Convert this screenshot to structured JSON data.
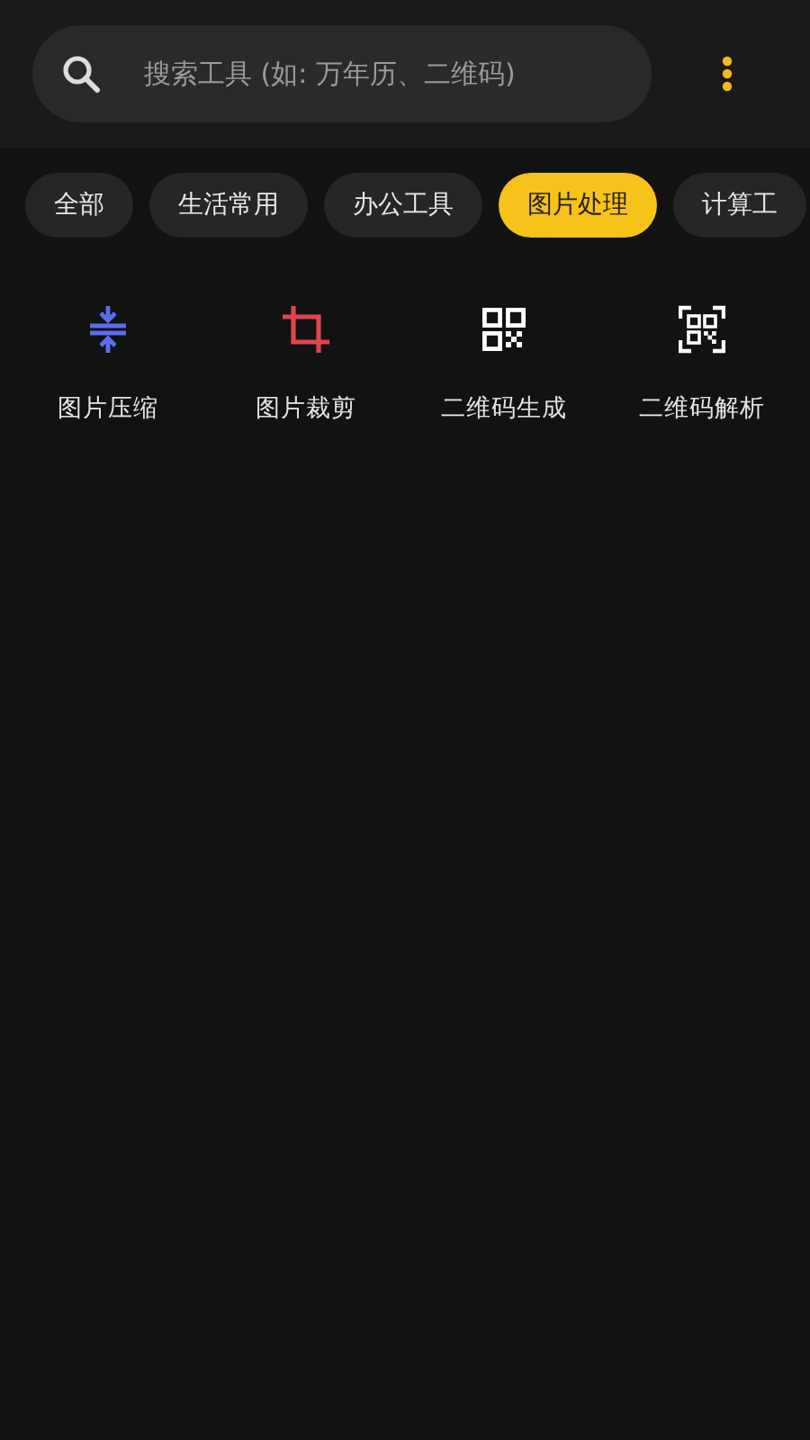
{
  "search": {
    "placeholder": "搜索工具 (如: 万年历、二维码)"
  },
  "tabs": [
    {
      "label": "全部",
      "selected": false
    },
    {
      "label": "生活常用",
      "selected": false
    },
    {
      "label": "办公工具",
      "selected": false
    },
    {
      "label": "图片处理",
      "selected": true
    },
    {
      "label": "计算工",
      "selected": false
    }
  ],
  "tools": [
    {
      "label": "图片压缩",
      "kind": "compress"
    },
    {
      "label": "图片裁剪",
      "kind": "crop"
    },
    {
      "label": "二维码生成",
      "kind": "qr"
    },
    {
      "label": "二维码解析",
      "kind": "scan"
    }
  ]
}
